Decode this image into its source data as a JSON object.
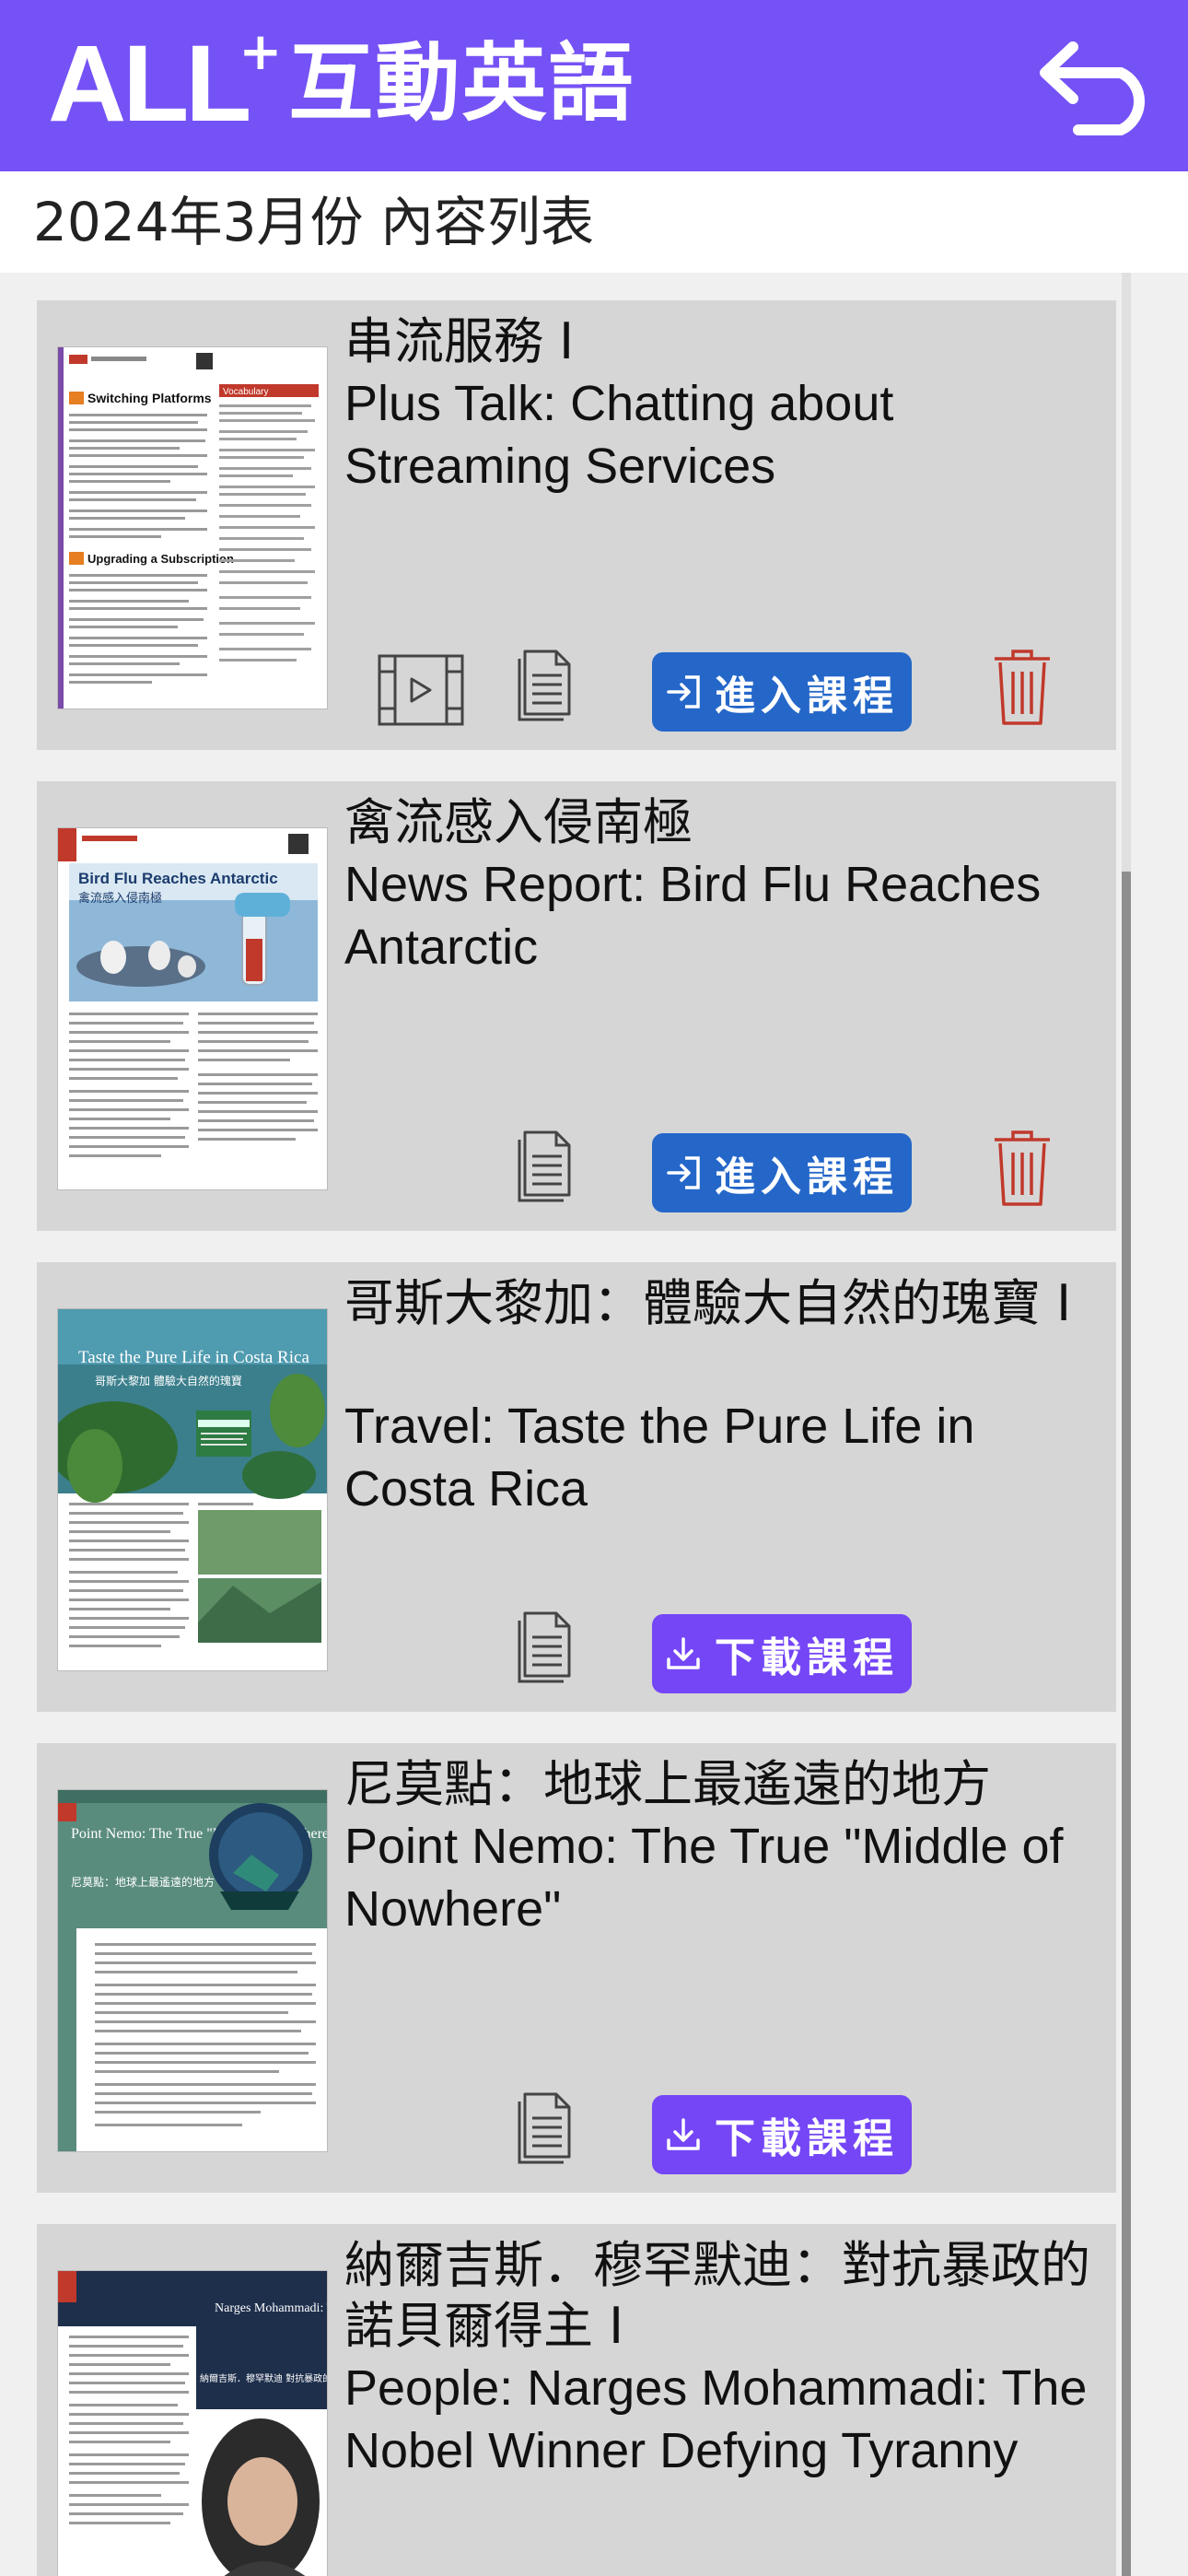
{
  "app": {
    "logo_text": "ALL",
    "logo_plus": "+",
    "logo_subtitle": "互動英語",
    "back_icon": "back-arrow-icon"
  },
  "page": {
    "subtitle": "2024年3月份 內容列表"
  },
  "colors": {
    "header": "#7552f5",
    "enter_button": "#2467c9",
    "download_button": "#7446f6",
    "delete_icon": "#c0392b",
    "card_bg": "#d6d6d6"
  },
  "lessons": [
    {
      "title_cn": "串流服務 I",
      "title_en": "Plus Talk: Chatting about Streaming Services",
      "has_video": true,
      "action": "進入課程",
      "action_icon": "enter-icon",
      "has_delete": true
    },
    {
      "title_cn": "禽流感入侵南極",
      "title_en": "News Report: Bird Flu Reaches Antarctic",
      "has_video": false,
      "action": "進入課程",
      "action_icon": "enter-icon",
      "has_delete": true,
      "thumb_heading": "Bird Flu Reaches Antarctic",
      "thumb_sub": "禽流感入侵南極"
    },
    {
      "title_cn": "哥斯大黎加：體驗大自然的瑰寶 I",
      "title_en": "Travel: Taste the Pure Life in Costa Rica",
      "has_video": false,
      "action": "下載課程",
      "action_icon": "download-icon",
      "has_delete": false,
      "thumb_heading": "Taste the Pure Life in Costa Rica",
      "thumb_sub": "哥斯大黎加 體驗大自然的瑰寶"
    },
    {
      "title_cn": "尼莫點：地球上最遙遠的地方",
      "title_en": "Point Nemo: The True \"Middle of Nowhere\"",
      "has_video": false,
      "action": "下載課程",
      "action_icon": "download-icon",
      "has_delete": false,
      "thumb_heading": "Point Nemo: The True \"Middle of Nowhere\"",
      "thumb_sub": "尼莫點：地球上最遙遠的地方"
    },
    {
      "title_cn": "納爾吉斯．穆罕默迪：對抗暴政的諾貝爾得主 I",
      "title_en": "People: Narges Mohammadi: The Nobel Winner Defying Tyranny",
      "thumb_heading": "Narges Mohammadi: The Nobel Winner Defying Tyranny",
      "thumb_sub": "納爾吉斯．穆罕默迪 對抗暴政的諾貝爾得主"
    }
  ],
  "card1_thumb": {
    "h1": "Switching Platforms",
    "h2": "Upgrading a Subscription",
    "vocab": "Vocabulary"
  }
}
